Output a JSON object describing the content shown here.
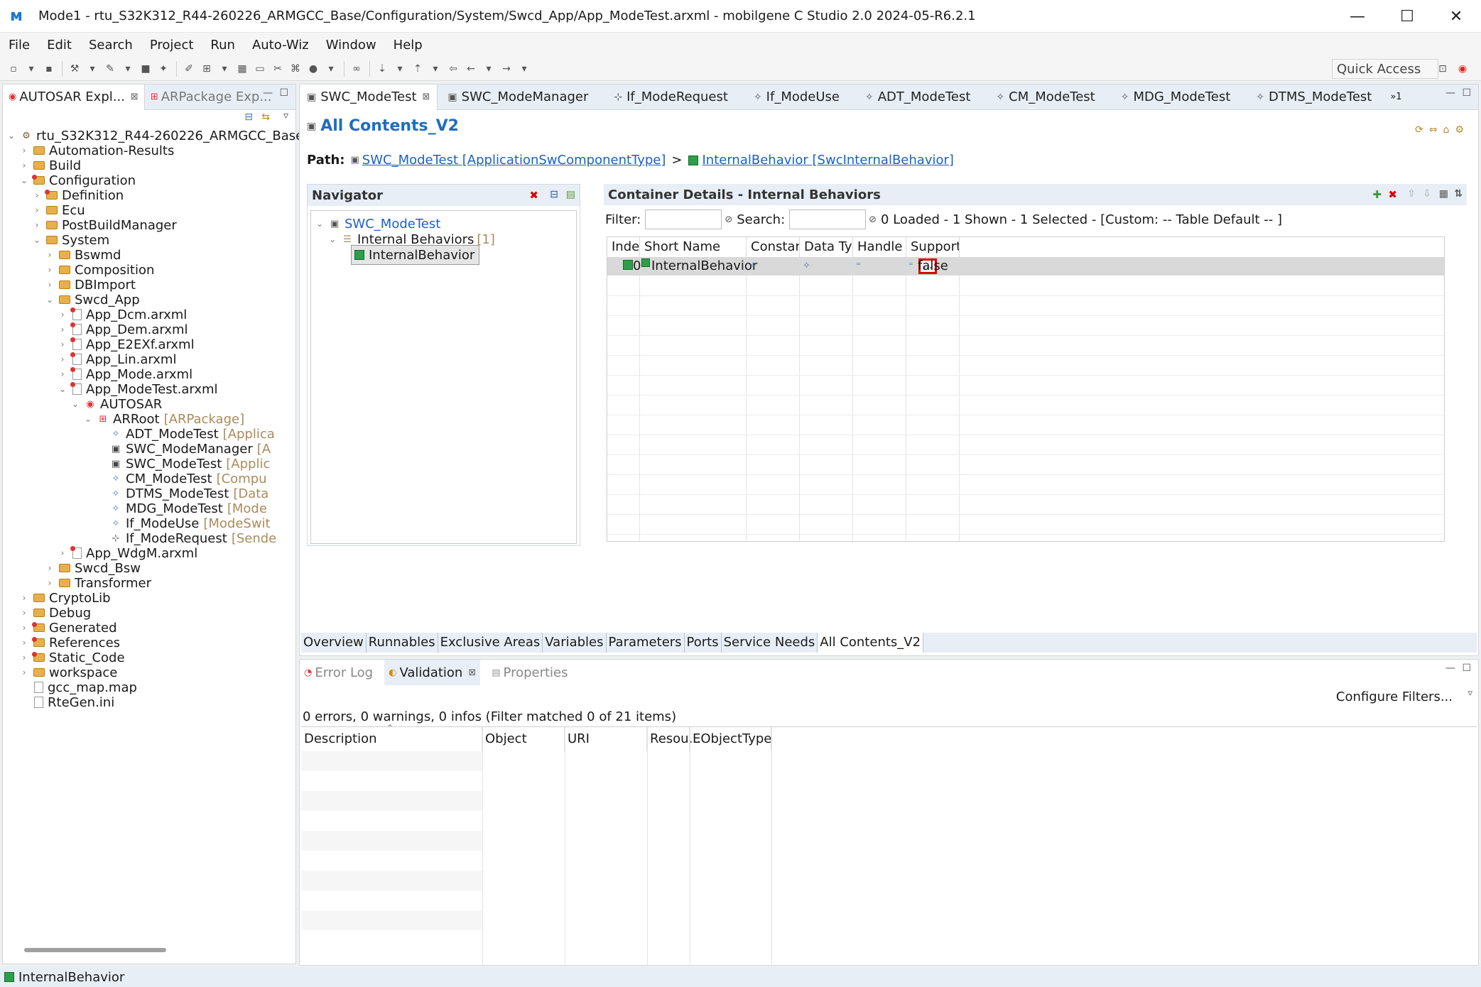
{
  "window": {
    "title": "Mode1 - rtu_S32K312_R44-260226_ARMGCC_Base/Configuration/System/Swcd_App/App_ModeTest.arxml - mobilgene C Studio 2.0 2024-05-R6.2.1",
    "minimize": "—",
    "maximize": "☐",
    "close": "✕"
  },
  "menu": [
    "File",
    "Edit",
    "Search",
    "Project",
    "Run",
    "Auto-Wiz",
    "Window",
    "Help"
  ],
  "toolbar": {
    "quick_access": "Quick Access"
  },
  "left_panel": {
    "tabs": [
      {
        "label": "AUTOSAR Expl...",
        "close": "⊠"
      },
      {
        "label": "ARPackage Exp...",
        "close": ""
      }
    ],
    "tree": [
      {
        "label": "rtu_S32K312_R44-260226_ARMGCC_Base",
        "suffix": "",
        "level": 0,
        "twisty": "⌄",
        "icon": "project"
      },
      {
        "label": "Automation-Results",
        "suffix": "",
        "level": 1,
        "twisty": "›",
        "icon": "folder"
      },
      {
        "label": "Build",
        "suffix": "",
        "level": 1,
        "twisty": "›",
        "icon": "folder"
      },
      {
        "label": "Configuration",
        "suffix": "",
        "level": 1,
        "twisty": "⌄",
        "icon": "folder-red"
      },
      {
        "label": "Definition",
        "suffix": "",
        "level": 2,
        "twisty": "›",
        "icon": "folder-red"
      },
      {
        "label": "Ecu",
        "suffix": "",
        "level": 2,
        "twisty": "›",
        "icon": "folder"
      },
      {
        "label": "PostBuildManager",
        "suffix": "",
        "level": 2,
        "twisty": "›",
        "icon": "folder"
      },
      {
        "label": "System",
        "suffix": "",
        "level": 2,
        "twisty": "⌄",
        "icon": "folder"
      },
      {
        "label": "Bswmd",
        "suffix": "",
        "level": 3,
        "twisty": "›",
        "icon": "folder"
      },
      {
        "label": "Composition",
        "suffix": "",
        "level": 3,
        "twisty": "›",
        "icon": "folder"
      },
      {
        "label": "DBImport",
        "suffix": "",
        "level": 3,
        "twisty": "›",
        "icon": "folder"
      },
      {
        "label": "Swcd_App",
        "suffix": "",
        "level": 3,
        "twisty": "⌄",
        "icon": "folder"
      },
      {
        "label": "App_Dcm.arxml",
        "suffix": "",
        "level": 4,
        "twisty": "›",
        "icon": "file"
      },
      {
        "label": "App_Dem.arxml",
        "suffix": "",
        "level": 4,
        "twisty": "›",
        "icon": "file"
      },
      {
        "label": "App_E2EXf.arxml",
        "suffix": "",
        "level": 4,
        "twisty": "›",
        "icon": "file"
      },
      {
        "label": "App_Lin.arxml",
        "suffix": "",
        "level": 4,
        "twisty": "›",
        "icon": "file"
      },
      {
        "label": "App_Mode.arxml",
        "suffix": "",
        "level": 4,
        "twisty": "›",
        "icon": "file"
      },
      {
        "label": "App_ModeTest.arxml",
        "suffix": "",
        "level": 4,
        "twisty": "⌄",
        "icon": "file"
      },
      {
        "label": "AUTOSAR",
        "suffix": "",
        "level": 5,
        "twisty": "⌄",
        "icon": "autosar"
      },
      {
        "label": "ARRoot",
        "suffix": "[ARPackage]",
        "level": 6,
        "twisty": "⌄",
        "icon": "package"
      },
      {
        "label": "ADT_ModeTest",
        "suffix": "[Applica",
        "level": 7,
        "twisty": "",
        "icon": "star"
      },
      {
        "label": "SWC_ModeManager",
        "suffix": "[A",
        "level": 7,
        "twisty": "",
        "icon": "component"
      },
      {
        "label": "SWC_ModeTest",
        "suffix": "[Applic",
        "level": 7,
        "twisty": "",
        "icon": "component"
      },
      {
        "label": "CM_ModeTest",
        "suffix": "[Compu",
        "level": 7,
        "twisty": "",
        "icon": "star"
      },
      {
        "label": "DTMS_ModeTest",
        "suffix": "[Data",
        "level": 7,
        "twisty": "",
        "icon": "star"
      },
      {
        "label": "MDG_ModeTest",
        "suffix": "[Mode",
        "level": 7,
        "twisty": "",
        "icon": "star"
      },
      {
        "label": "If_ModeUse",
        "suffix": "[ModeSwit",
        "level": 7,
        "twisty": "",
        "icon": "star"
      },
      {
        "label": "If_ModeRequest",
        "suffix": "[Sende",
        "level": 7,
        "twisty": "",
        "icon": "interface"
      },
      {
        "label": "App_WdgM.arxml",
        "suffix": "",
        "level": 4,
        "twisty": "›",
        "icon": "file"
      },
      {
        "label": "Swcd_Bsw",
        "suffix": "",
        "level": 3,
        "twisty": "›",
        "icon": "folder"
      },
      {
        "label": "Transformer",
        "suffix": "",
        "level": 3,
        "twisty": "›",
        "icon": "folder"
      },
      {
        "label": "CryptoLib",
        "suffix": "",
        "level": 1,
        "twisty": "›",
        "icon": "folder"
      },
      {
        "label": "Debug",
        "suffix": "",
        "level": 1,
        "twisty": "›",
        "icon": "folder"
      },
      {
        "label": "Generated",
        "suffix": "",
        "level": 1,
        "twisty": "›",
        "icon": "folder-red"
      },
      {
        "label": "References",
        "suffix": "",
        "level": 1,
        "twisty": "›",
        "icon": "folder-red"
      },
      {
        "label": "Static_Code",
        "suffix": "",
        "level": 1,
        "twisty": "›",
        "icon": "folder-red"
      },
      {
        "label": "workspace",
        "suffix": "",
        "level": 1,
        "twisty": "›",
        "icon": "folder"
      },
      {
        "label": "gcc_map.map",
        "suffix": "",
        "level": 1,
        "twisty": "",
        "icon": "plainfile"
      },
      {
        "label": "RteGen.ini",
        "suffix": "",
        "level": 1,
        "twisty": "",
        "icon": "plainfile"
      }
    ]
  },
  "editor": {
    "tabs": [
      {
        "label": "SWC_ModeTest",
        "icon": "▣",
        "active": true,
        "close": "⊠"
      },
      {
        "label": "SWC_ModeManager",
        "icon": "▣",
        "active": false,
        "close": ""
      },
      {
        "label": "If_ModeRequest",
        "icon": "⊹",
        "active": false,
        "close": ""
      },
      {
        "label": "If_ModeUse",
        "icon": "✧",
        "active": false,
        "close": ""
      },
      {
        "label": "ADT_ModeTest",
        "icon": "✧",
        "active": false,
        "close": ""
      },
      {
        "label": "CM_ModeTest",
        "icon": "✧",
        "active": false,
        "close": ""
      },
      {
        "label": "MDG_ModeTest",
        "icon": "✧",
        "active": false,
        "close": ""
      },
      {
        "label": "DTMS_ModeTest",
        "icon": "✧",
        "active": false,
        "close": ""
      }
    ],
    "overflow": "»1",
    "heading": "All Contents_V2",
    "path_label": "Path:",
    "path_link1": "SWC_ModeTest [ApplicationSwComponentType]",
    "path_sep": ">",
    "path_link2": "InternalBehavior [SwcInternalBehavior]",
    "navigator": {
      "title": "Navigator",
      "root": "SWC_ModeTest",
      "group": "Internal Behaviors",
      "group_count": "[1]",
      "leaf": "InternalBehavior"
    },
    "container": {
      "title": "Container Details - Internal Behaviors",
      "filter_label": "Filter:",
      "search_label": "Search:",
      "status": "0 Loaded - 1 Shown - 1 Selected -  [Custom: -- Table Default -- ]",
      "columns": [
        "Index",
        "Short Name",
        "Constant...",
        "Data Typ...",
        "Handle T...",
        "Supports..."
      ],
      "row": {
        "index": "0",
        "short_name": "InternalBehavior",
        "ellipsis": "...",
        "supports": "false"
      }
    },
    "bottom_tabs": [
      "Overview",
      "Runnables",
      "Exclusive Areas",
      "Variables",
      "Parameters",
      "Ports",
      "Service Needs",
      "All Contents_V2"
    ]
  },
  "validation": {
    "tabs": [
      {
        "label": "Error Log",
        "active": false,
        "close": ""
      },
      {
        "label": "Validation",
        "active": true,
        "close": "⊠"
      },
      {
        "label": "Properties",
        "active": false,
        "close": ""
      }
    ],
    "configure": "Configure Filters...",
    "summary": "0 errors, 0 warnings, 0 infos (Filter matched 0 of 21 items)",
    "columns": [
      "Description",
      "Object",
      "URI",
      "Resou...",
      "EObjectType"
    ]
  },
  "status_bar": {
    "selection": "InternalBehavior"
  },
  "colors": {
    "accent": "#1f6dc1",
    "link": "#1f5fbf",
    "highlight": "#e00000",
    "panel_header": "#e8eef6"
  }
}
